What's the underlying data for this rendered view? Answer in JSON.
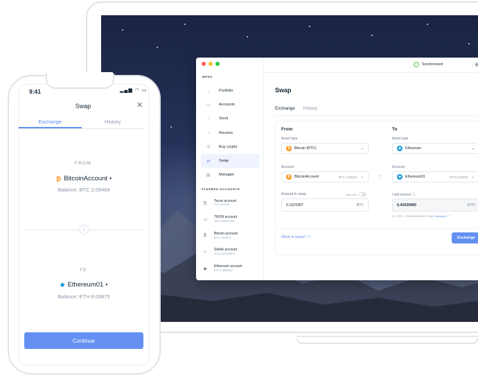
{
  "desktop": {
    "menu_label": "MENU",
    "nav": [
      {
        "label": "Portfolio",
        "icon": "chart-icon"
      },
      {
        "label": "Accounts",
        "icon": "accounts-icon"
      },
      {
        "label": "Send",
        "icon": "send-icon"
      },
      {
        "label": "Receive",
        "icon": "receive-icon"
      },
      {
        "label": "Buy crypto",
        "icon": "buy-icon"
      },
      {
        "label": "Swap",
        "icon": "swap-icon"
      },
      {
        "label": "Manager",
        "icon": "manager-icon"
      }
    ],
    "starred_label": "STARRED ACCOUNTS",
    "starred": [
      {
        "name": "Tezos account",
        "balance": "XTZ 15.9736"
      },
      {
        "name": "TRON account",
        "balance": "TRX 2,396.67967"
      },
      {
        "name": "Bitcoin account",
        "balance": "BTC 0.010227"
      },
      {
        "name": "Stellar account",
        "balance": "XLM 4,872.00874"
      },
      {
        "name": "Ethereum account",
        "balance": "ETH 2.9865345"
      }
    ],
    "sync_status": "Synchronized",
    "title": "Swap",
    "tabs": [
      "Exchange",
      "History"
    ],
    "from": {
      "title": "From",
      "asset_type_label": "Asset type",
      "asset": "Bitcoin (BTC)",
      "account_label": "Account",
      "account": "BitcoinAccount",
      "account_balance": "BTC 2.09464",
      "amount_label": "Amount to swap",
      "use_max": "Use max",
      "amount": "0.1629387",
      "amount_unit": "BTC"
    },
    "to": {
      "title": "To",
      "asset_type_label": "Asset type",
      "asset": "Ethereum",
      "account_label": "Account",
      "account": "Ethereum01",
      "account_balance": "ETH 8.03875",
      "receive_label": "I will receive",
      "receive": "6.41020683",
      "receive_unit": "ETH",
      "rate": "1 BTC = 39.50575608 ETH",
      "by": "By",
      "provider": "Changelly"
    },
    "what_is_swap": "What is swap?",
    "exchange_button": "Exchange"
  },
  "mobile": {
    "time": "9:41",
    "title": "Swap",
    "tabs": [
      "Exchange",
      "History"
    ],
    "from_label": "FROM",
    "from_account": "BitcoinAccount",
    "from_balance": "Balance: BTC 2.09464",
    "to_label": "TO",
    "to_account": "Ethereum01",
    "to_balance": "Balance: ETH 8.03875",
    "continue_button": "Continue"
  },
  "colors": {
    "accent": "#6490f1",
    "bitcoin": "#f7931a",
    "ethereum": "#1a9bd8",
    "synced": "#66be54"
  }
}
